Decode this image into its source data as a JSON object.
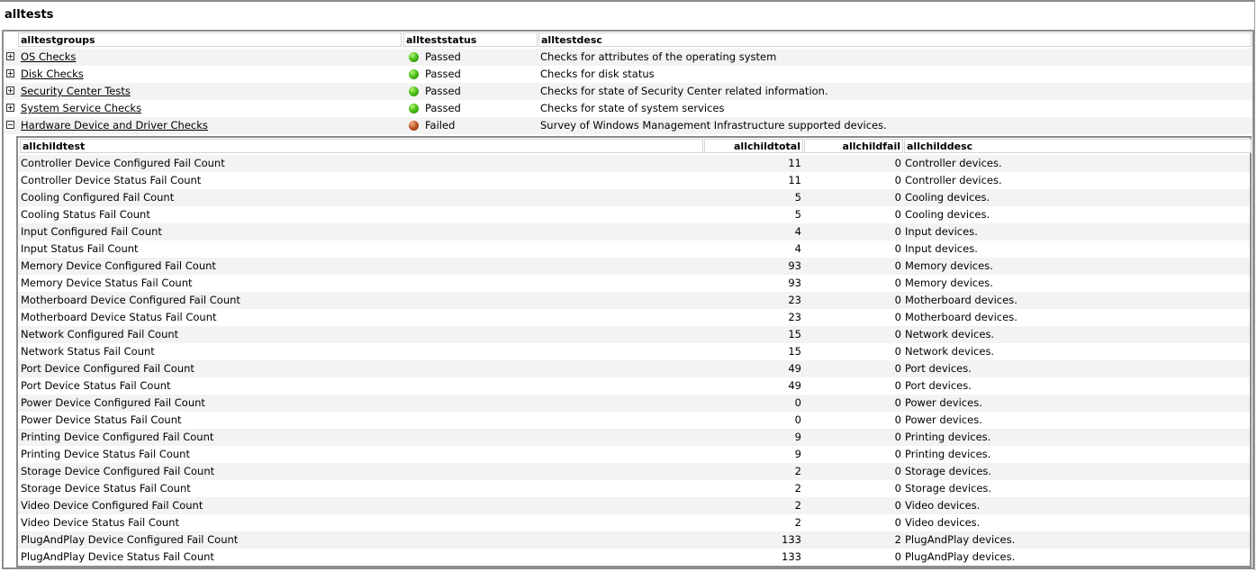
{
  "title": "alltests",
  "groups_table": {
    "columns": [
      "alltestgroups",
      "allteststatus",
      "alltestdesc"
    ],
    "rows": [
      {
        "name": "OS Checks",
        "status": "Passed",
        "status_color": "#4fc218",
        "desc": "Checks for attributes of the operating system",
        "expanded": false
      },
      {
        "name": "Disk Checks",
        "status": "Passed",
        "status_color": "#4fc218",
        "desc": "Checks for disk status",
        "expanded": false
      },
      {
        "name": "Security Center Tests",
        "status": "Passed",
        "status_color": "#4fc218",
        "desc": "Checks for state of Security Center related information.",
        "expanded": false
      },
      {
        "name": "System Service Checks",
        "status": "Passed",
        "status_color": "#4fc218",
        "desc": "Checks for state of system services",
        "expanded": false
      },
      {
        "name": "Hardware Device and Driver Checks",
        "status": "Failed",
        "status_color": "#c3582a",
        "desc": "Survey of Windows Management Infrastructure supported devices.",
        "expanded": true
      }
    ]
  },
  "child_table": {
    "columns": [
      "allchildtest",
      "allchildtotal",
      "allchildfail",
      "allchilddesc"
    ],
    "rows": [
      {
        "test": "Controller Device Configured Fail Count",
        "total": "11",
        "fail": "0",
        "desc": "Controller devices."
      },
      {
        "test": "Controller Device Status Fail Count",
        "total": "11",
        "fail": "0",
        "desc": "Controller devices."
      },
      {
        "test": "Cooling Configured Fail Count",
        "total": "5",
        "fail": "0",
        "desc": "Cooling devices."
      },
      {
        "test": "Cooling Status Fail Count",
        "total": "5",
        "fail": "0",
        "desc": "Cooling devices."
      },
      {
        "test": "Input Configured Fail Count",
        "total": "4",
        "fail": "0",
        "desc": "Input devices."
      },
      {
        "test": "Input Status Fail Count",
        "total": "4",
        "fail": "0",
        "desc": "Input devices."
      },
      {
        "test": "Memory Device Configured Fail Count",
        "total": "93",
        "fail": "0",
        "desc": "Memory devices."
      },
      {
        "test": "Memory Device Status Fail Count",
        "total": "93",
        "fail": "0",
        "desc": "Memory devices."
      },
      {
        "test": "Motherboard Device Configured Fail Count",
        "total": "23",
        "fail": "0",
        "desc": "Motherboard devices."
      },
      {
        "test": "Motherboard Device Status Fail Count",
        "total": "23",
        "fail": "0",
        "desc": "Motherboard devices."
      },
      {
        "test": "Network Configured Fail Count",
        "total": "15",
        "fail": "0",
        "desc": "Network devices."
      },
      {
        "test": "Network Status Fail Count",
        "total": "15",
        "fail": "0",
        "desc": "Network devices."
      },
      {
        "test": "Port Device Configured Fail Count",
        "total": "49",
        "fail": "0",
        "desc": "Port devices."
      },
      {
        "test": "Port Device Status Fail Count",
        "total": "49",
        "fail": "0",
        "desc": "Port devices."
      },
      {
        "test": "Power Device Configured Fail Count",
        "total": "0",
        "fail": "0",
        "desc": "Power devices."
      },
      {
        "test": "Power Device Status Fail Count",
        "total": "0",
        "fail": "0",
        "desc": "Power devices."
      },
      {
        "test": "Printing Device Configured Fail Count",
        "total": "9",
        "fail": "0",
        "desc": "Printing devices."
      },
      {
        "test": "Printing Device Status Fail Count",
        "total": "9",
        "fail": "0",
        "desc": "Printing devices."
      },
      {
        "test": "Storage Device Configured Fail Count",
        "total": "2",
        "fail": "0",
        "desc": "Storage devices."
      },
      {
        "test": "Storage Device Status Fail Count",
        "total": "2",
        "fail": "0",
        "desc": "Storage devices."
      },
      {
        "test": "Video Device Configured Fail Count",
        "total": "2",
        "fail": "0",
        "desc": "Video devices."
      },
      {
        "test": "Video Device Status Fail Count",
        "total": "2",
        "fail": "0",
        "desc": "Video devices."
      },
      {
        "test": "PlugAndPlay Device Configured Fail Count",
        "total": "133",
        "fail": "2",
        "desc": "PlugAndPlay devices."
      },
      {
        "test": "PlugAndPlay Device Status Fail Count",
        "total": "133",
        "fail": "0",
        "desc": "PlugAndPlay devices."
      }
    ]
  }
}
